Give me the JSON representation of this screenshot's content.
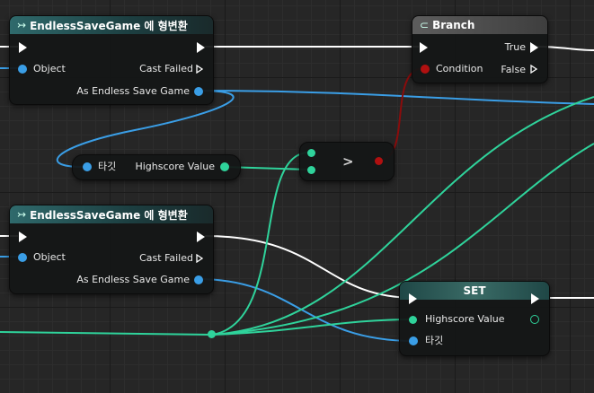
{
  "cast_node_1": {
    "title": "EndlessSaveGame 에 형변환",
    "object_label": "Object",
    "cast_failed_label": "Cast Failed",
    "as_label": "As Endless Save Game"
  },
  "cast_node_2": {
    "title": "EndlessSaveGame 에 형변환",
    "object_label": "Object",
    "cast_failed_label": "Cast Failed",
    "as_label": "As Endless Save Game"
  },
  "branch_node": {
    "title": "Branch",
    "condition_label": "Condition",
    "true_label": "True",
    "false_label": "False"
  },
  "getter_node": {
    "target_label": "타깃",
    "value_label": "Highscore Value"
  },
  "compare_node": {
    "operator": ">"
  },
  "set_node": {
    "title": "SET",
    "value_label": "Highscore Value",
    "target_label": "타깃"
  },
  "colors": {
    "object_pin": "#3a9ee6",
    "float_pin": "#2fd39b",
    "bool_pin": "#b01010",
    "exec_wire": "#ffffff",
    "cast_header": "#2f6a6c",
    "set_header": "#3a6b66"
  },
  "icons": {
    "cast": "cast-arrow-icon",
    "branch": "branch-icon"
  }
}
